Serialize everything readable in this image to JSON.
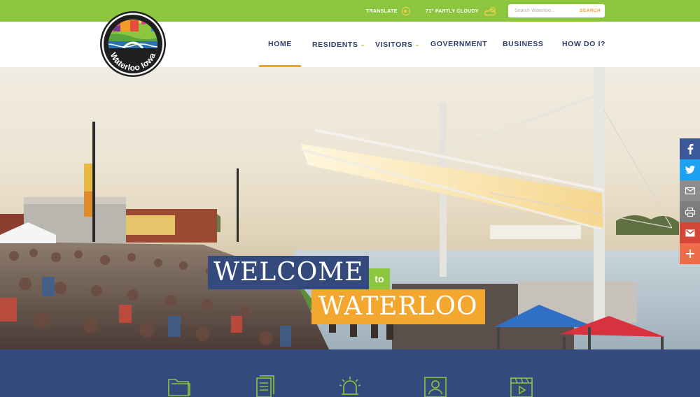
{
  "colors": {
    "green": "#8cc63f",
    "navy": "#344a7c",
    "orange": "#f3a72e",
    "nav_text": "#2d3e6b"
  },
  "utility": {
    "translate_label": "TRANSLATE",
    "translate_icon": "translate-icon",
    "weather_label": "71° PARTLY CLOUDY",
    "weather_icon": "partly-cloudy-icon",
    "search_placeholder": "Search Waterloo...",
    "search_button_label": "SEARCH"
  },
  "logo": {
    "text": "Waterloo Iowa"
  },
  "nav": {
    "items": [
      {
        "label": "HOME",
        "active": true,
        "has_dropdown": false
      },
      {
        "label": "RESIDENTS",
        "active": false,
        "has_dropdown": true
      },
      {
        "label": "VISITORS",
        "active": false,
        "has_dropdown": true
      },
      {
        "label": "GOVERNMENT",
        "active": false,
        "has_dropdown": false
      },
      {
        "label": "BUSINESS",
        "active": false,
        "has_dropdown": false
      },
      {
        "label": "HOW DO I?",
        "active": false,
        "has_dropdown": false
      }
    ]
  },
  "hero": {
    "welcome": "WELCOME",
    "to": "to",
    "city": "WATERLOO"
  },
  "share": {
    "buttons": [
      {
        "icon": "facebook-icon",
        "color": "#3b5998"
      },
      {
        "icon": "twitter-icon",
        "color": "#1da1f2"
      },
      {
        "icon": "email-icon",
        "color": "#8d8d8d"
      },
      {
        "icon": "print-icon",
        "color": "#7d7d7d"
      },
      {
        "icon": "gmail-icon",
        "color": "#d44638"
      },
      {
        "icon": "more-share-icon",
        "color": "#ef6c4a"
      }
    ]
  },
  "quick_links": {
    "icons": [
      "folder-icon",
      "document-icon",
      "alert-bell-icon",
      "profile-card-icon",
      "video-player-icon"
    ]
  }
}
